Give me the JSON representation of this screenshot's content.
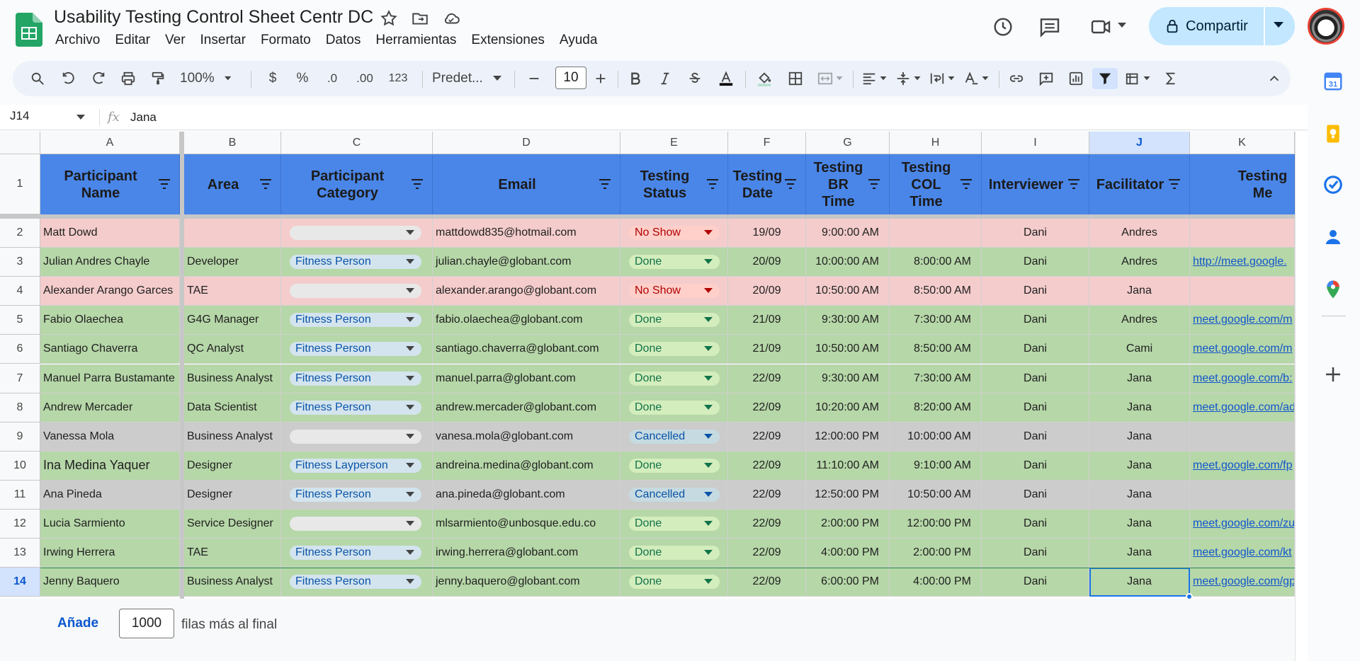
{
  "doc": {
    "title": "Usability Testing Control Sheet Centr DC",
    "menu": [
      "Archivo",
      "Editar",
      "Ver",
      "Insertar",
      "Formato",
      "Datos",
      "Herramientas",
      "Extensiones",
      "Ayuda"
    ],
    "share_label": "Compartir"
  },
  "toolbar": {
    "zoom": "100%",
    "currency": "$",
    "percent": "%",
    "dec_decrease": ".0",
    "dec_increase": ".00",
    "num_format": "123",
    "font": "Predet...",
    "font_size": "10"
  },
  "formula_bar": {
    "cell_ref": "J14",
    "fx": "fx",
    "value": "Jana"
  },
  "columns": [
    "A",
    "B",
    "C",
    "D",
    "E",
    "F",
    "G",
    "H",
    "I",
    "J",
    "K"
  ],
  "rows": [
    "1",
    "2",
    "3",
    "4",
    "5",
    "6",
    "7",
    "8",
    "9",
    "10",
    "11",
    "12",
    "13",
    "14"
  ],
  "headers": [
    "Participant Name",
    "Area",
    "Participant Category",
    "Email",
    "Testing Status",
    "Testing Date",
    "Testing BR Time",
    "Testing COL Time",
    "Interviewer",
    "Facilitator",
    "Testing Me"
  ],
  "data": [
    {
      "name": "Matt Dowd",
      "area": "",
      "category": "",
      "email": "mattdowd835@hotmail.com",
      "status": "No Show",
      "date": "19/09",
      "br": "9:00:00 AM",
      "col": "",
      "interviewer": "Dani",
      "facilitator": "Andres",
      "meet": ""
    },
    {
      "name": "Julian Andres Chayle",
      "area": "Developer",
      "category": "Fitness Person",
      "email": "julian.chayle@globant.com",
      "status": "Done",
      "date": "20/09",
      "br": "10:00:00 AM",
      "col": "8:00:00 AM",
      "interviewer": "Dani",
      "facilitator": "Andres",
      "meet": "http://meet.google."
    },
    {
      "name": "Alexander Arango Garces",
      "area": "TAE",
      "category": "",
      "email": "alexander.arango@globant.com",
      "status": "No Show",
      "date": "20/09",
      "br": "10:50:00 AM",
      "col": "8:50:00 AM",
      "interviewer": "Dani",
      "facilitator": "Jana",
      "meet": ""
    },
    {
      "name": "Fabio Olaechea",
      "area": "G4G Manager",
      "category": "Fitness Person",
      "email": "fabio.olaechea@globant.com",
      "status": "Done",
      "date": "21/09",
      "br": "9:30:00 AM",
      "col": "7:30:00 AM",
      "interviewer": "Dani",
      "facilitator": "Andres",
      "meet": "meet.google.com/m"
    },
    {
      "name": "Santiago Chaverra",
      "area": "QC Analyst",
      "category": "Fitness Person",
      "email": "santiago.chaverra@globant.com",
      "status": "Done",
      "date": "21/09",
      "br": "10:50:00 AM",
      "col": "8:50:00 AM",
      "interviewer": "Dani",
      "facilitator": "Cami",
      "meet": "meet.google.com/m"
    },
    {
      "name": "Manuel Parra Bustamante",
      "area": "Business Analyst",
      "category": "Fitness Person",
      "email": "manuel.parra@globant.com",
      "status": "Done",
      "date": "22/09",
      "br": "9:30:00 AM",
      "col": "7:30:00 AM",
      "interviewer": "Dani",
      "facilitator": "Jana",
      "meet": "meet.google.com/b:"
    },
    {
      "name": "Andrew Mercader",
      "area": "Data Scientist",
      "category": "Fitness Person",
      "email": "andrew.mercader@globant.com",
      "status": "Done",
      "date": "22/09",
      "br": "10:20:00 AM",
      "col": "8:20:00 AM",
      "interviewer": "Dani",
      "facilitator": "Jana",
      "meet": "meet.google.com/ad"
    },
    {
      "name": "Vanessa Mola",
      "area": "Business Analyst",
      "category": "",
      "email": "vanesa.mola@globant.com",
      "status": "Cancelled",
      "date": "22/09",
      "br": "12:00:00 PM",
      "col": "10:00:00 AM",
      "interviewer": "Dani",
      "facilitator": "Jana",
      "meet": ""
    },
    {
      "name": "Ina Medina Yaquer",
      "area": "Designer",
      "category": "Fitness Layperson",
      "email": "andreina.medina@globant.com",
      "status": "Done",
      "date": "22/09",
      "br": "11:10:00 AM",
      "col": "9:10:00 AM",
      "interviewer": "Dani",
      "facilitator": "Jana",
      "meet": "meet.google.com/fp"
    },
    {
      "name": "Ana Pineda",
      "area": "Designer",
      "category": "Fitness Person",
      "email": "ana.pineda@globant.com",
      "status": "Cancelled",
      "date": "22/09",
      "br": "12:50:00 PM",
      "col": "10:50:00 AM",
      "interviewer": "Dani",
      "facilitator": "Jana",
      "meet": ""
    },
    {
      "name": "Lucia Sarmiento",
      "area": "Service Designer",
      "category": "",
      "email": "mlsarmiento@unbosque.edu.co",
      "status": "Done",
      "date": "22/09",
      "br": "2:00:00 PM",
      "col": "12:00:00 PM",
      "interviewer": "Dani",
      "facilitator": "Jana",
      "meet": "meet.google.com/zu"
    },
    {
      "name": "Irwing Herrera",
      "area": "TAE",
      "category": "Fitness Person",
      "email": "irwing.herrera@globant.com",
      "status": "Done",
      "date": "22/09",
      "br": "4:00:00 PM",
      "col": "2:00:00 PM",
      "interviewer": "Dani",
      "facilitator": "Jana",
      "meet": "meet.google.com/kt"
    },
    {
      "name": "Jenny Baquero",
      "area": "Business Analyst",
      "category": "Fitness Person",
      "email": "jenny.baquero@globant.com",
      "status": "Done",
      "date": "22/09",
      "br": "6:00:00 PM",
      "col": "4:00:00 PM",
      "interviewer": "Dani",
      "facilitator": "Jana",
      "meet": "meet.google.com/gp"
    }
  ],
  "footer": {
    "add_label": "Añade",
    "rows_value": "1000",
    "rows_text": "filas más al final"
  },
  "colors": {
    "header_blue": "#4a86e8",
    "no_show": "#f4cccc",
    "done": "#b6d7a8",
    "cancelled": "#cccccc"
  }
}
